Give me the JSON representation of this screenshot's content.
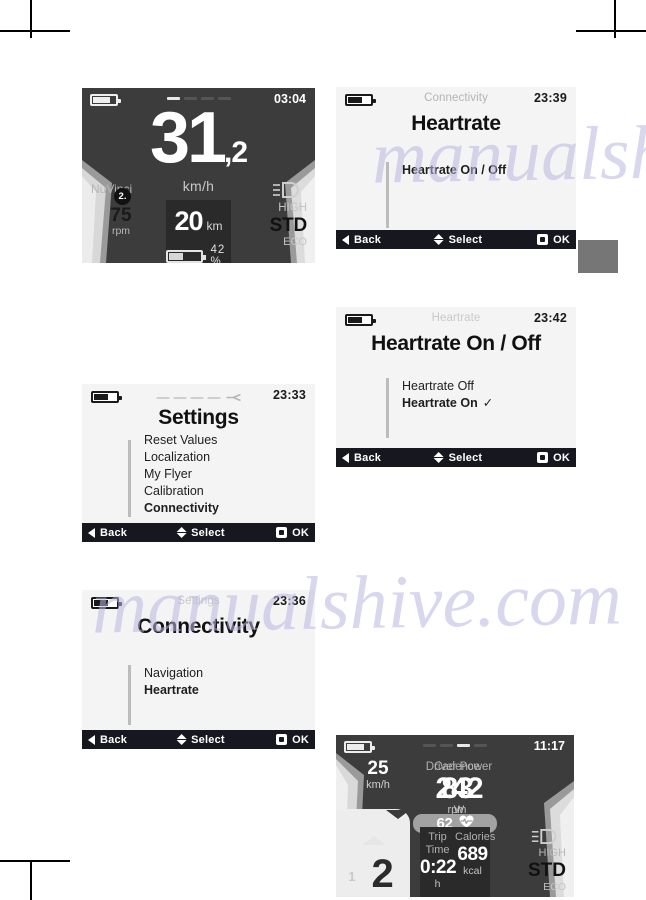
{
  "page": {
    "tab_color": "#767676",
    "watermark": [
      "manualshive.com",
      "manualshive.com"
    ]
  },
  "displays": {
    "speed_dash": {
      "name": "speed-dashboard",
      "clock": "03:04",
      "speed_int": "31",
      "speed_dec": ",2",
      "speed_unit": "km/h",
      "brand": "NuVinci",
      "callout": "2.",
      "cadence_value": "75",
      "cadence_unit": "rpm",
      "support_high": "HIGH",
      "support_std": "STD",
      "support_eco": "ECO",
      "distance_value": "20",
      "distance_unit": "km",
      "battery_percent": "42 %",
      "battery_fill": 42
    },
    "settings_menu": {
      "name": "settings-menu",
      "clock": "23:33",
      "breadcrumb": "",
      "title": "Settings",
      "items": [
        {
          "label": "Reset Values",
          "selected": false
        },
        {
          "label": "Localization",
          "selected": false
        },
        {
          "label": "My Flyer",
          "selected": false
        },
        {
          "label": "Calibration",
          "selected": false
        },
        {
          "label": "Connectivity",
          "selected": true
        }
      ],
      "nav": {
        "back": "Back",
        "select": "Select",
        "ok": "OK"
      }
    },
    "connectivity_menu": {
      "name": "connectivity-menu",
      "clock": "23:36",
      "breadcrumb": "Settings",
      "title": "Connectivity",
      "items": [
        {
          "label": "Navigation",
          "selected": false
        },
        {
          "label": "Heartrate",
          "selected": true
        }
      ],
      "nav": {
        "back": "Back",
        "select": "Select",
        "ok": "OK"
      }
    },
    "heartrate_menu": {
      "name": "heartrate-menu",
      "clock": "23:39",
      "breadcrumb": "Connectivity",
      "title": "Heartrate",
      "items": [
        {
          "label": "Heartrate On / Off",
          "selected": true
        }
      ],
      "nav": {
        "back": "Back",
        "select": "Select",
        "ok": "OK"
      }
    },
    "heartrate_onoff_menu": {
      "name": "heartrate-on-off-menu",
      "clock": "23:42",
      "breadcrumb": "Heartrate",
      "title": "Heartrate On / Off",
      "items": [
        {
          "label": "Heartrate Off",
          "selected": false,
          "check": ""
        },
        {
          "label": "Heartrate On",
          "selected": true,
          "check": "✓"
        }
      ],
      "nav": {
        "back": "Back",
        "select": "Select",
        "ok": "OK"
      }
    },
    "ride_dash": {
      "name": "ride-data-dashboard",
      "clock": "11:17",
      "speed_value": "25",
      "speed_unit": "km/h",
      "gear": "2",
      "gear_small": "1",
      "driver_power_label": "Driver Power",
      "driver_power_value": "242",
      "driver_power_unit": "W",
      "cadence_label": "Cadence",
      "cadence_value": "83",
      "cadence_unit": "rpm",
      "heartrate_value": "62",
      "trip_time_label": "Trip Time",
      "trip_time_value": "0:22",
      "trip_time_unit": "h",
      "calories_label": "Calories",
      "calories_value": "689",
      "calories_unit": "kcal",
      "support_high": "HIGH",
      "support_std": "STD",
      "support_eco": "ECO"
    }
  }
}
